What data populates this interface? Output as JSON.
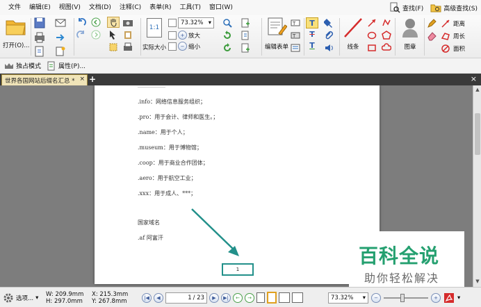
{
  "menu": [
    "文件",
    "编辑(E)",
    "视图(V)",
    "文档(D)",
    "注释(C)",
    "表单(R)",
    "工具(T)",
    "窗口(W)"
  ],
  "menu_right": {
    "find": "查找(F)",
    "advanced_find": "高级查找(S)"
  },
  "toolbar": {
    "open_label": "打开(O)...",
    "zoom_value": "73.32%",
    "zoom_in": "放大",
    "zoom_out": "缩小",
    "actual_size": "实际大小",
    "actual_size_icon": "1:1",
    "edit_form": "编辑表单",
    "line": "线条",
    "stamp": "图章",
    "distance": "距离",
    "perimeter": "周长",
    "area": "面积"
  },
  "row2": {
    "solo_mode": "独占模式",
    "properties": "属性(P)..."
  },
  "tab": {
    "title": "世界各国网站后缀名汇总 *",
    "close": "×",
    "add": "+",
    "close_all": "×"
  },
  "document": {
    "lines": [
      ".info：网络信息服务组织；",
      ".pro：用于会计、律师和医生。；",
      ".name：用于个人；",
      ".museum：用于博物馆；",
      ".coop：用于商业合作团体；",
      ".aero：用于航空工业；",
      ".xxx：用于成人、***；",
      "国家域名",
      ".af 阿富汗"
    ],
    "page_number": "1"
  },
  "watermark": {
    "title": "百科全说",
    "subtitle": "助你轻松解决"
  },
  "status": {
    "options": "选项...",
    "width": "W: 209.9mm",
    "height": "H: 297.0mm",
    "x": "X: 215.3mm",
    "y": "Y: 267.8mm",
    "page_field": "1",
    "page_total": "/ 23",
    "zoom": "73.32%"
  },
  "colors": {
    "accent": "#22908a",
    "watermark_green": "#25a070",
    "tab_bg": "#f0e4b8"
  }
}
